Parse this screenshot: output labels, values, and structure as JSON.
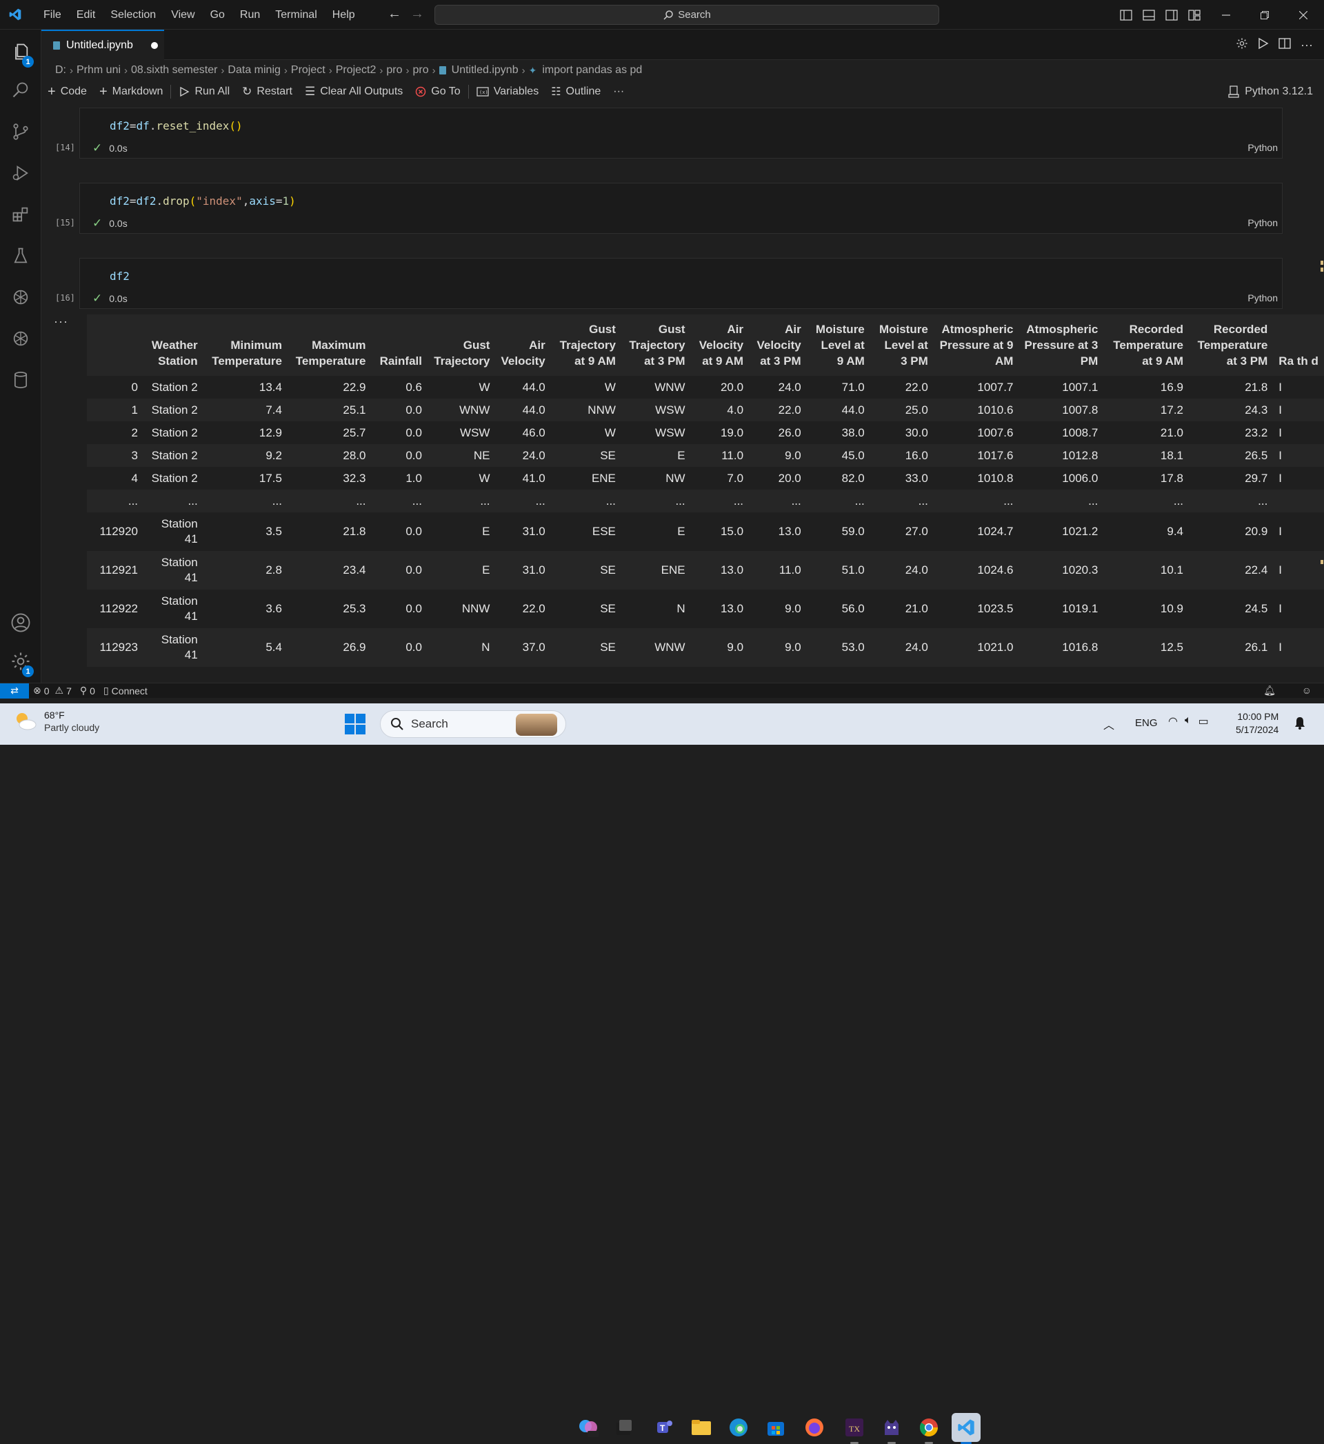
{
  "menu": [
    "File",
    "Edit",
    "Selection",
    "View",
    "Go",
    "Run",
    "Terminal",
    "Help"
  ],
  "command_search": {
    "label": "Search"
  },
  "activity_badges": {
    "explorer": "1",
    "settings": "1"
  },
  "tab": {
    "title": "Untitled.ipynb"
  },
  "breadcrumb": [
    "D:",
    "Prhm uni",
    "08.sixth semester",
    "Data minig",
    "Project",
    "Project2",
    "pro",
    "pro",
    "Untitled.ipynb",
    "import pandas as pd"
  ],
  "toolbar": {
    "code": "Code",
    "markdown": "Markdown",
    "run_all": "Run All",
    "restart": "Restart",
    "clear_outputs": "Clear All Outputs",
    "go_to": "Go To",
    "variables": "Variables",
    "outline": "Outline",
    "more": "···"
  },
  "kernel": "Python 3.12.1",
  "cells": [
    {
      "exec": "[14]",
      "time": "0.0s",
      "lang": "Python"
    },
    {
      "exec": "[15]",
      "time": "0.0s",
      "lang": "Python"
    },
    {
      "exec": "[16]",
      "time": "0.0s",
      "lang": "Python"
    }
  ],
  "cell_code": {
    "c14": {
      "var": "df2",
      "eq": "=",
      "obj": "df",
      "dot": ".",
      "fn": "reset_index",
      "args": "()"
    },
    "c15": {
      "var": "df2",
      "eq": "=",
      "obj": "df2",
      "dot": ".",
      "fn": "drop",
      "p1": "(",
      "str": "\"index\"",
      "comma": ",",
      "kw": "axis",
      "eq2": "=",
      "num": "1",
      "p2": ")"
    },
    "c16": {
      "var": "df2"
    }
  },
  "output_more": "···",
  "dataframe": {
    "columns": [
      "Weather Station",
      "Minimum Temperature",
      "Maximum Temperature",
      "Rainfall",
      "Gust Trajectory",
      "Air Velocity",
      "Gust Trajectory at 9 AM",
      "Gust Trajectory at 3 PM",
      "Air Velocity at 9 AM",
      "Air Velocity at 3 PM",
      "Moisture Level at 9 AM",
      "Moisture Level at 3 PM",
      "Atmospheric Pressure at 9 AM",
      "Atmospheric Pressure at 3 PM",
      "Recorded Temperature at 9 AM",
      "Recorded Temperature at 3 PM",
      "Ra th d"
    ],
    "rows": [
      {
        "idx": "0",
        "cells": [
          "Station 2",
          "13.4",
          "22.9",
          "0.6",
          "W",
          "44.0",
          "W",
          "WNW",
          "20.0",
          "24.0",
          "71.0",
          "22.0",
          "1007.7",
          "1007.1",
          "16.9",
          "21.8",
          "I"
        ]
      },
      {
        "idx": "1",
        "cells": [
          "Station 2",
          "7.4",
          "25.1",
          "0.0",
          "WNW",
          "44.0",
          "NNW",
          "WSW",
          "4.0",
          "22.0",
          "44.0",
          "25.0",
          "1010.6",
          "1007.8",
          "17.2",
          "24.3",
          "I"
        ]
      },
      {
        "idx": "2",
        "cells": [
          "Station 2",
          "12.9",
          "25.7",
          "0.0",
          "WSW",
          "46.0",
          "W",
          "WSW",
          "19.0",
          "26.0",
          "38.0",
          "30.0",
          "1007.6",
          "1008.7",
          "21.0",
          "23.2",
          "I"
        ]
      },
      {
        "idx": "3",
        "cells": [
          "Station 2",
          "9.2",
          "28.0",
          "0.0",
          "NE",
          "24.0",
          "SE",
          "E",
          "11.0",
          "9.0",
          "45.0",
          "16.0",
          "1017.6",
          "1012.8",
          "18.1",
          "26.5",
          "I"
        ]
      },
      {
        "idx": "4",
        "cells": [
          "Station 2",
          "17.5",
          "32.3",
          "1.0",
          "W",
          "41.0",
          "ENE",
          "NW",
          "7.0",
          "20.0",
          "82.0",
          "33.0",
          "1010.8",
          "1006.0",
          "17.8",
          "29.7",
          "I"
        ]
      },
      {
        "idx": "...",
        "cells": [
          "...",
          "...",
          "...",
          "...",
          "...",
          "...",
          "...",
          "...",
          "...",
          "...",
          "...",
          "...",
          "...",
          "...",
          "...",
          "...",
          ""
        ]
      },
      {
        "idx": "112920",
        "cells": [
          "Station 41",
          "3.5",
          "21.8",
          "0.0",
          "E",
          "31.0",
          "ESE",
          "E",
          "15.0",
          "13.0",
          "59.0",
          "27.0",
          "1024.7",
          "1021.2",
          "9.4",
          "20.9",
          "I"
        ]
      },
      {
        "idx": "112921",
        "cells": [
          "Station 41",
          "2.8",
          "23.4",
          "0.0",
          "E",
          "31.0",
          "SE",
          "ENE",
          "13.0",
          "11.0",
          "51.0",
          "24.0",
          "1024.6",
          "1020.3",
          "10.1",
          "22.4",
          "I"
        ]
      },
      {
        "idx": "112922",
        "cells": [
          "Station 41",
          "3.6",
          "25.3",
          "0.0",
          "NNW",
          "22.0",
          "SE",
          "N",
          "13.0",
          "9.0",
          "56.0",
          "21.0",
          "1023.5",
          "1019.1",
          "10.9",
          "24.5",
          "I"
        ]
      },
      {
        "idx": "112923",
        "cells": [
          "Station 41",
          "5.4",
          "26.9",
          "0.0",
          "N",
          "37.0",
          "SE",
          "WNW",
          "9.0",
          "9.0",
          "53.0",
          "24.0",
          "1021.0",
          "1016.8",
          "12.5",
          "26.1",
          "I"
        ]
      }
    ]
  },
  "statusbar": {
    "errors": "0",
    "warnings": "7",
    "ports": "0",
    "connect": "Connect"
  },
  "taskbar": {
    "weather_temp": "68°F",
    "weather_desc": "Partly cloudy",
    "search": "Search",
    "lang": "ENG",
    "time": "10:00 PM",
    "date": "5/17/2024"
  },
  "colors": {
    "accent": "#0078d4",
    "check": "#89d185",
    "bg": "#1f1f1f"
  }
}
